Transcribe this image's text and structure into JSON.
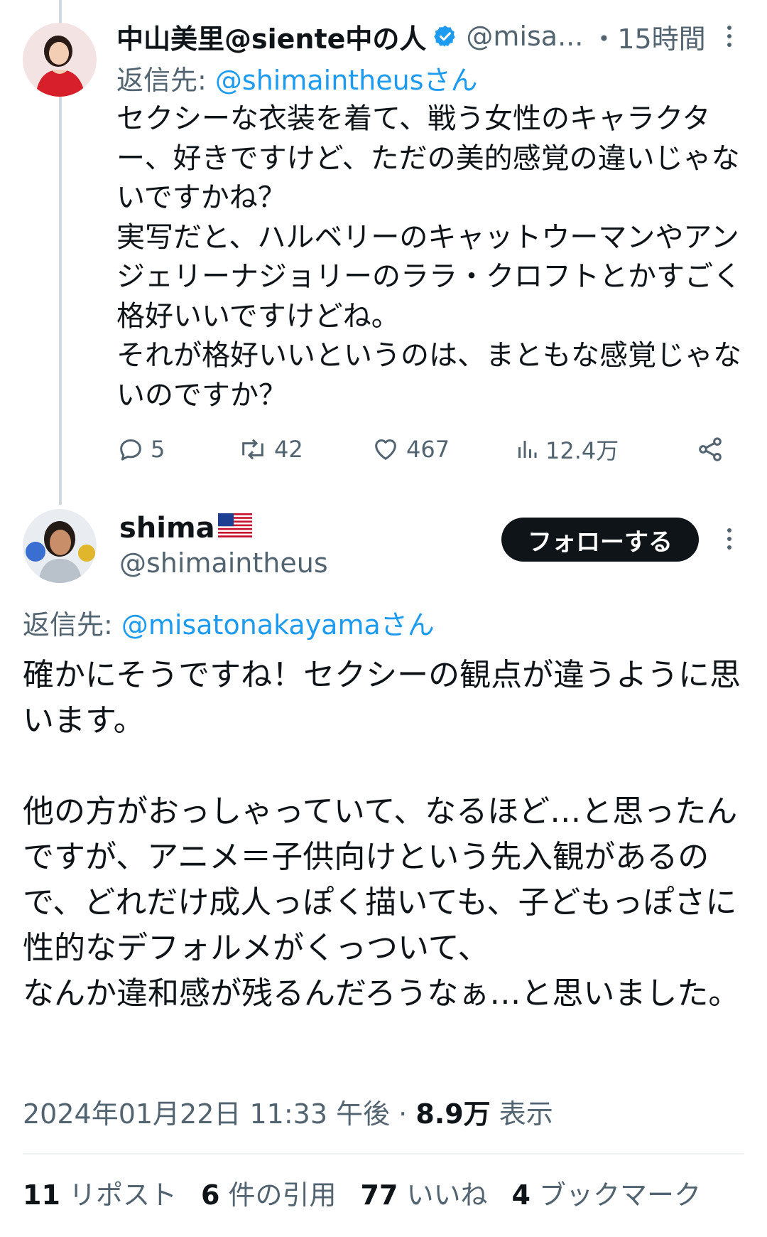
{
  "tweet1": {
    "author_name": "中山美里@siente中の人",
    "handle": "@misa...",
    "time": "・15時間",
    "reply_label": "返信先: ",
    "reply_handle": "@shimaintheusさん",
    "body": "セクシーな衣装を着て、戦う女性のキャラクター、好きですけど、ただの美的感覚の違いじゃないですかね？\n実写だと、ハルベリーのキャットウーマンやアンジェリーナジョリーのララ・クロフトとかすごく格好いいですけどね。\nそれが格好いいというのは、まともな感覚じゃないのですか？",
    "actions": {
      "replies": "5",
      "reposts": "42",
      "likes": "467",
      "views": "12.4万"
    },
    "icons": [
      "avatar",
      "verified-badge-icon",
      "more-icon",
      "reply-icon",
      "repost-icon",
      "like-icon",
      "views-icon",
      "share-icon"
    ]
  },
  "tweet2": {
    "author_name": "shima",
    "flag": "us-flag-icon",
    "handle": "@shimaintheus",
    "follow_label": "フォローする",
    "reply_label": "返信先: ",
    "reply_handle": "@misatonakayamaさん",
    "body": "確かにそうですね！セクシーの観点が違うように思います。\n\n他の方がおっしゃっていて、なるほど…と思ったんですが、アニメ＝子供向けという先入観があるので、どれだけ成人っぽく描いても、子どもっぽさに性的なデフォルメがくっついて、\nなんか違和感が残るんだろうなぁ…と思いました。",
    "timestamp": "2024年01月22日 11:33 午後",
    "views_sep": " · ",
    "views_count": "8.9万",
    "views_label": " 表示",
    "stats": [
      {
        "count": "11",
        "label": " リポスト"
      },
      {
        "count": "6",
        "label": " 件の引用"
      },
      {
        "count": "77",
        "label": " いいね"
      },
      {
        "count": "4",
        "label": " ブックマーク"
      }
    ]
  },
  "colors": {
    "link": "#1d9bf0",
    "secondary_text": "#536471",
    "primary_text": "#0f1419",
    "thread_line": "#cfd9de",
    "follow_button_bg": "#0f1419"
  }
}
